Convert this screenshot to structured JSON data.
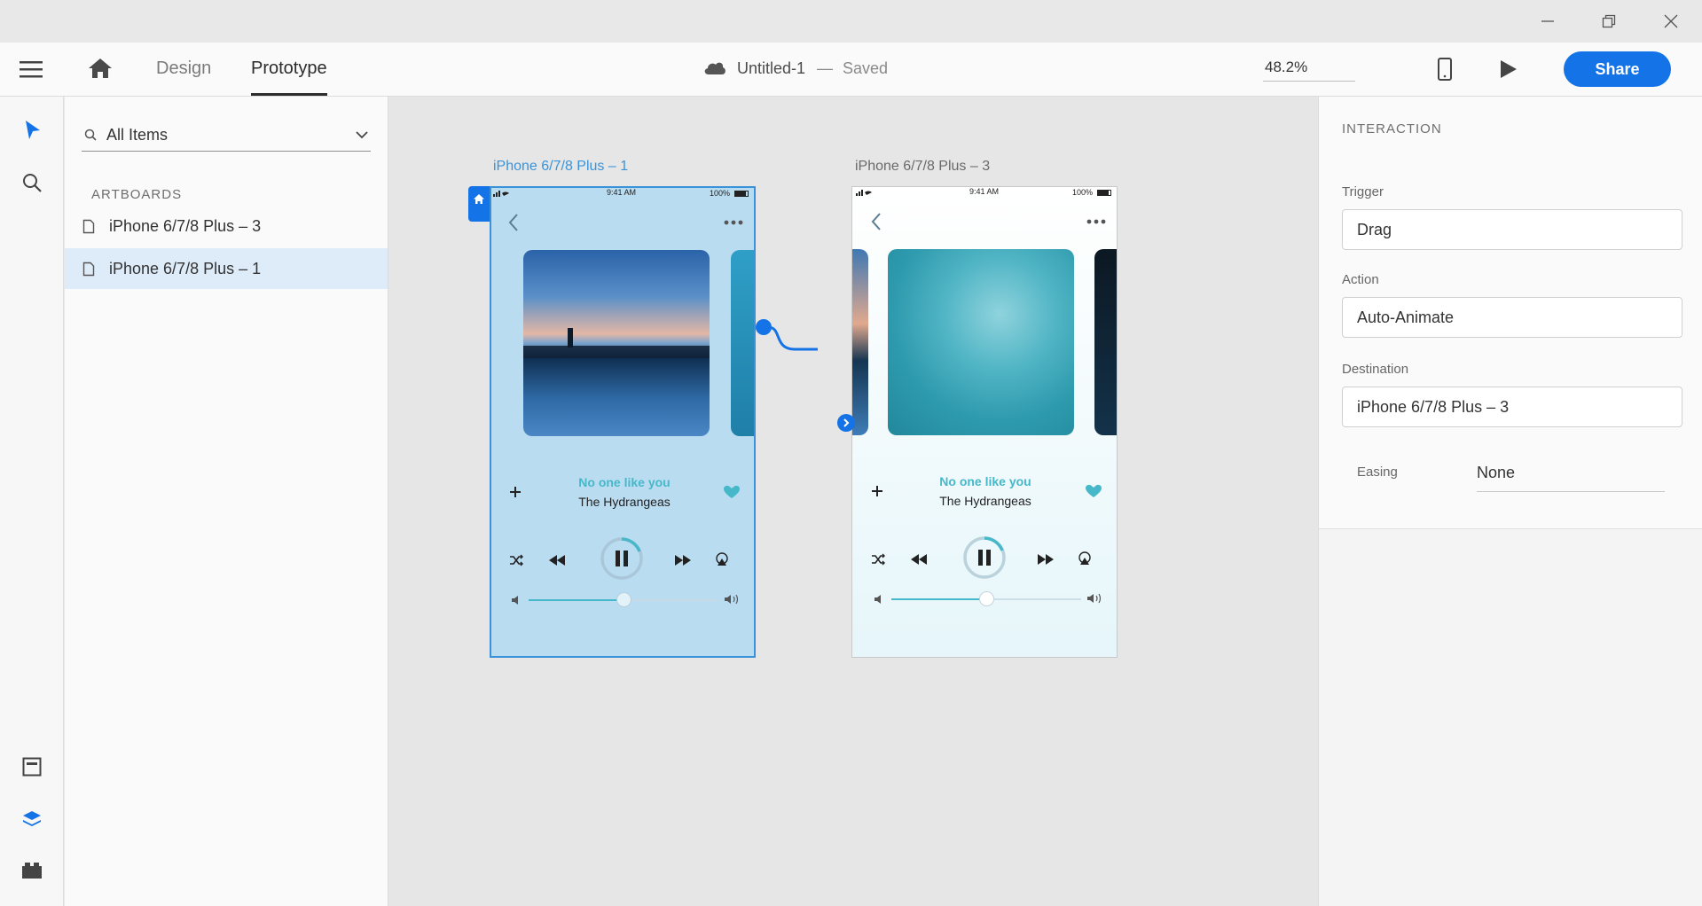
{
  "app": {
    "colors": {
      "accent": "#1473e6",
      "selection": "#3a93d9",
      "song_teal": "#47b8c9"
    }
  },
  "window": {
    "controls": [
      "minimize",
      "restore",
      "close"
    ]
  },
  "toolbar": {
    "tabs": [
      {
        "label": "Design",
        "active": false
      },
      {
        "label": "Prototype",
        "active": true
      }
    ],
    "doc_title": "Untitled-1",
    "doc_separator": "—",
    "doc_status": "Saved",
    "zoom": "48.2%",
    "share_label": "Share"
  },
  "panel": {
    "search_placeholder": "All Items",
    "section_title": "ARTBOARDS",
    "artboards": [
      {
        "label": "iPhone 6/7/8 Plus – 3",
        "selected": false
      },
      {
        "label": "iPhone 6/7/8 Plus – 1",
        "selected": true
      }
    ]
  },
  "canvas": {
    "artboards": [
      {
        "label": "iPhone 6/7/8 Plus – 1",
        "time": "9:41 AM",
        "battery": "100%",
        "song_title": "No one like you",
        "song_artist": "The Hydrangeas",
        "volume": 0.5
      },
      {
        "label": "iPhone 6/7/8 Plus – 3",
        "time": "9:41 AM",
        "battery": "100%",
        "song_title": "No one like you",
        "song_artist": "The Hydrangeas",
        "volume": 0.5
      }
    ]
  },
  "interaction": {
    "section_title": "INTERACTION",
    "trigger_label": "Trigger",
    "trigger_value": "Drag",
    "action_label": "Action",
    "action_value": "Auto-Animate",
    "destination_label": "Destination",
    "destination_value": "iPhone 6/7/8 Plus – 3",
    "easing_label": "Easing",
    "easing_value": "None"
  }
}
